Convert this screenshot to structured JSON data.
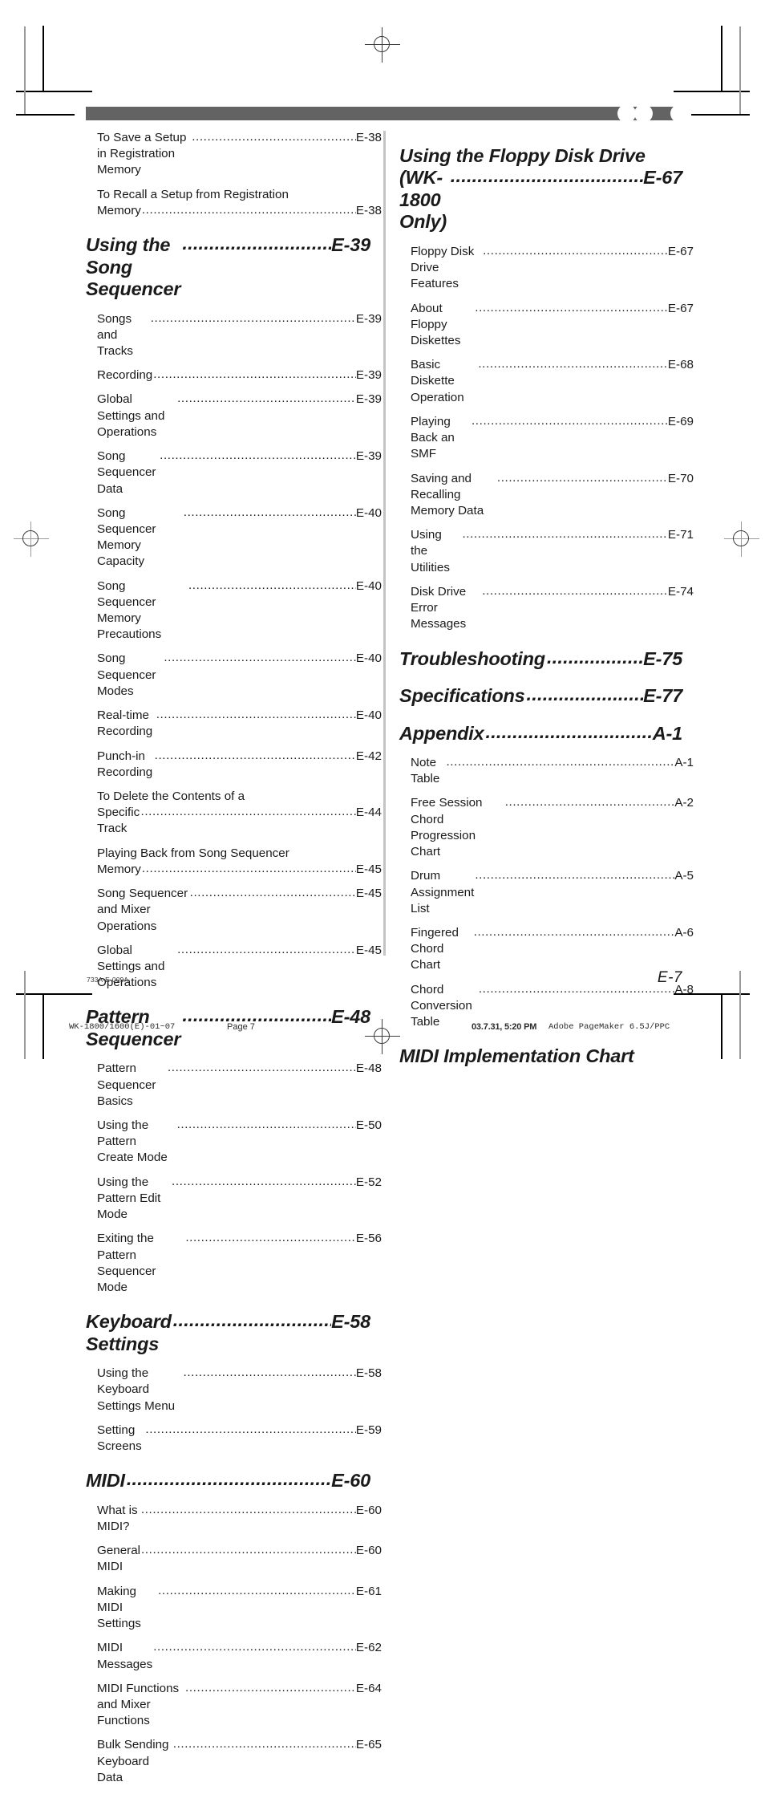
{
  "document": {
    "doc_code": "733A-E-009A",
    "folio": "E-7"
  },
  "slug": {
    "file": "WK-1800/1600(E)-01~07",
    "page": "Page 7",
    "date": "03.7.31, 5:20 PM",
    "app": "Adobe PageMaker 6.5J/PPC"
  },
  "leader": "..................................................................................................",
  "toc": {
    "left_column": [
      {
        "type": "sub",
        "label": "To Save a Setup in Registration Memory",
        "page": "E-38"
      },
      {
        "type": "sub2",
        "line1": "To Recall a Setup from Registration",
        "line2": "Memory",
        "page": "E-38"
      },
      {
        "type": "head",
        "label": "Using the Song Sequencer",
        "page": "E-39"
      },
      {
        "type": "sub",
        "label": "Songs and Tracks",
        "page": "E-39"
      },
      {
        "type": "sub",
        "label": "Recording",
        "page": "E-39"
      },
      {
        "type": "sub",
        "label": "Global Settings and Operations",
        "page": "E-39"
      },
      {
        "type": "sub",
        "label": "Song Sequencer Data",
        "page": "E-39"
      },
      {
        "type": "sub",
        "label": "Song Sequencer Memory Capacity",
        "page": "E-40"
      },
      {
        "type": "sub",
        "label": "Song Sequencer Memory Precautions",
        "page": "E-40"
      },
      {
        "type": "sub",
        "label": "Song Sequencer Modes",
        "page": "E-40"
      },
      {
        "type": "sub",
        "label": "Real-time Recording",
        "page": "E-40"
      },
      {
        "type": "sub",
        "label": "Punch-in Recording",
        "page": "E-42"
      },
      {
        "type": "sub2",
        "line1": "To Delete the Contents of a",
        "line2": "Specific Track",
        "page": "E-44"
      },
      {
        "type": "sub2",
        "line1": "Playing Back from Song Sequencer",
        "line2": "Memory",
        "page": "E-45"
      },
      {
        "type": "sub",
        "label": "Song Sequencer and Mixer Operations",
        "page": "E-45"
      },
      {
        "type": "sub",
        "label": "Global Settings and Operations",
        "page": "E-45"
      },
      {
        "type": "head",
        "label": "Pattern Sequencer",
        "page": "E-48"
      },
      {
        "type": "sub",
        "label": "Pattern Sequencer Basics",
        "page": "E-48"
      },
      {
        "type": "sub",
        "label": "Using the Pattern Create Mode",
        "page": "E-50"
      },
      {
        "type": "sub",
        "label": "Using the Pattern Edit Mode",
        "page": "E-52"
      },
      {
        "type": "sub",
        "label": "Exiting the Pattern Sequencer Mode",
        "page": "E-56"
      },
      {
        "type": "head",
        "label": "Keyboard Settings",
        "page": "E-58"
      },
      {
        "type": "sub",
        "label": "Using the Keyboard Settings Menu",
        "page": "E-58"
      },
      {
        "type": "sub",
        "label": "Setting Screens",
        "page": "E-59"
      },
      {
        "type": "head",
        "label": "MIDI",
        "page": "E-60"
      },
      {
        "type": "sub",
        "label": "What is MIDI?",
        "page": "E-60"
      },
      {
        "type": "sub",
        "label": "General MIDI",
        "page": "E-60"
      },
      {
        "type": "sub",
        "label": "Making MIDI Settings",
        "page": "E-61"
      },
      {
        "type": "sub",
        "label": "MIDI Messages",
        "page": "E-62"
      },
      {
        "type": "sub",
        "label": "MIDI Functions and Mixer Functions",
        "page": "E-64"
      },
      {
        "type": "sub",
        "label": "Bulk Sending Keyboard Data",
        "page": "E-65"
      }
    ],
    "right_column": [
      {
        "type": "head2",
        "line1": "Using the Floppy Disk Drive",
        "line2": "(WK-1800 Only)",
        "page": "E-67"
      },
      {
        "type": "sub",
        "label": "Floppy Disk Drive Features",
        "page": "E-67"
      },
      {
        "type": "sub",
        "label": "About Floppy Diskettes",
        "page": "E-67"
      },
      {
        "type": "sub",
        "label": "Basic Diskette Operation",
        "page": "E-68"
      },
      {
        "type": "sub",
        "label": "Playing Back an SMF",
        "page": "E-69"
      },
      {
        "type": "sub",
        "label": "Saving and Recalling Memory Data",
        "page": "E-70"
      },
      {
        "type": "sub",
        "label": "Using the Utilities",
        "page": "E-71"
      },
      {
        "type": "sub",
        "label": "Disk Drive Error Messages",
        "page": "E-74"
      },
      {
        "type": "head",
        "label": "Troubleshooting",
        "page": "E-75"
      },
      {
        "type": "head",
        "label": "Specifications",
        "page": "E-77"
      },
      {
        "type": "head",
        "label": "Appendix",
        "page": "A-1"
      },
      {
        "type": "sub",
        "label": "Note Table",
        "page": "A-1"
      },
      {
        "type": "sub",
        "label": "Free Session Chord Progression Chart",
        "page": "A-2"
      },
      {
        "type": "sub",
        "label": "Drum Assignment List",
        "page": "A-5"
      },
      {
        "type": "sub",
        "label": "Fingered Chord Chart",
        "page": "A-6"
      },
      {
        "type": "sub",
        "label": "Chord Conversion Table",
        "page": "A-8"
      },
      {
        "type": "head-plain",
        "label": "MIDI Implementation Chart",
        "page": ""
      }
    ]
  }
}
